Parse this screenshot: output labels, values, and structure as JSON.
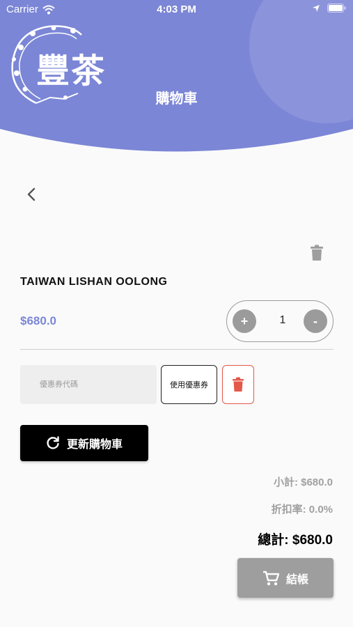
{
  "status_bar": {
    "carrier": "Carrier",
    "time": "4:03 PM"
  },
  "header": {
    "logo_text": "豐茶",
    "title": "購物車",
    "accent_color": "#7b86d6"
  },
  "cart": {
    "items": [
      {
        "name": "TAIWAN LISHAN OOLONG",
        "price": "$680.0",
        "quantity": "1"
      }
    ],
    "stepper": {
      "plus_label": "+",
      "minus_label": "-"
    }
  },
  "coupon": {
    "placeholder": "優惠券代碼",
    "apply_label": "使用優惠券"
  },
  "actions": {
    "update_cart_label": "更新購物車",
    "checkout_label": "結帳"
  },
  "summary": {
    "subtotal": "小計: $680.0",
    "discount": "折扣率: 0.0%",
    "total": "總計: $680.0"
  },
  "icons": {
    "back": "chevron-left-icon",
    "trash": "trash-icon",
    "refresh": "refresh-icon",
    "cart": "cart-icon"
  },
  "colors": {
    "delete_red": "#e4584a",
    "muted_gray": "#9e9e9e"
  }
}
